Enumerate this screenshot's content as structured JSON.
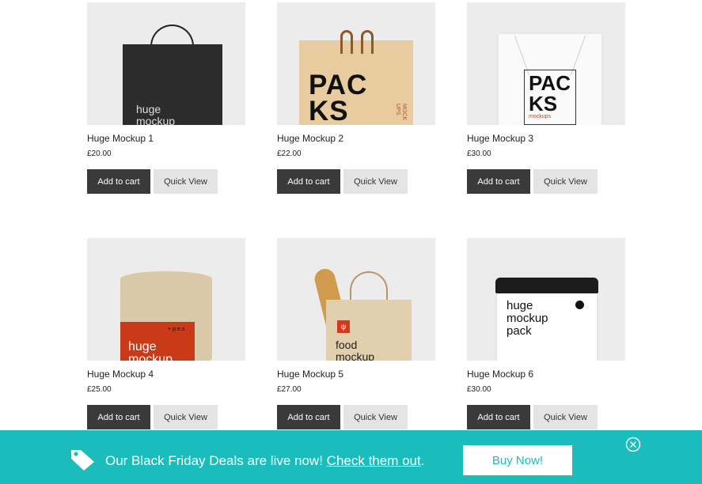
{
  "products": [
    {
      "name": "Huge Mockup 1",
      "price": "£20.00",
      "cart_label": "Add to cart",
      "quick_label": "Quick View",
      "art_text": "huge\nmockup"
    },
    {
      "name": "Huge Mockup 2",
      "price": "£22.00",
      "cart_label": "Add to cart",
      "quick_label": "Quick View",
      "art_text": "PAC\nKS",
      "art_sub": "MOCK UPS"
    },
    {
      "name": "Huge Mockup 3",
      "price": "£30.00",
      "cart_label": "Add to cart",
      "quick_label": "Quick View",
      "art_text": "PAC\nKS",
      "art_sub": "mockups"
    },
    {
      "name": "Huge Mockup 4",
      "price": "£25.00",
      "cart_label": "Add to cart",
      "quick_label": "Quick View",
      "art_text": "huge\nmockup",
      "art_sub": "+ p.e.s"
    },
    {
      "name": "Huge Mockup 5",
      "price": "£27.00",
      "cart_label": "Add to cart",
      "quick_label": "Quick View",
      "art_text": "food\nmockup",
      "art_logo": "ψ"
    },
    {
      "name": "Huge Mockup 6",
      "price": "£30.00",
      "cart_label": "Add to cart",
      "quick_label": "Quick View",
      "art_text": "huge\nmockup\npack"
    }
  ],
  "banner": {
    "text": "Our Black Friday Deals are live now!",
    "link": "Check them out",
    "period": ".",
    "button": "Buy Now!",
    "background": "#1bbcbc",
    "icon": "tag-icon",
    "close_icon": "close-icon"
  }
}
